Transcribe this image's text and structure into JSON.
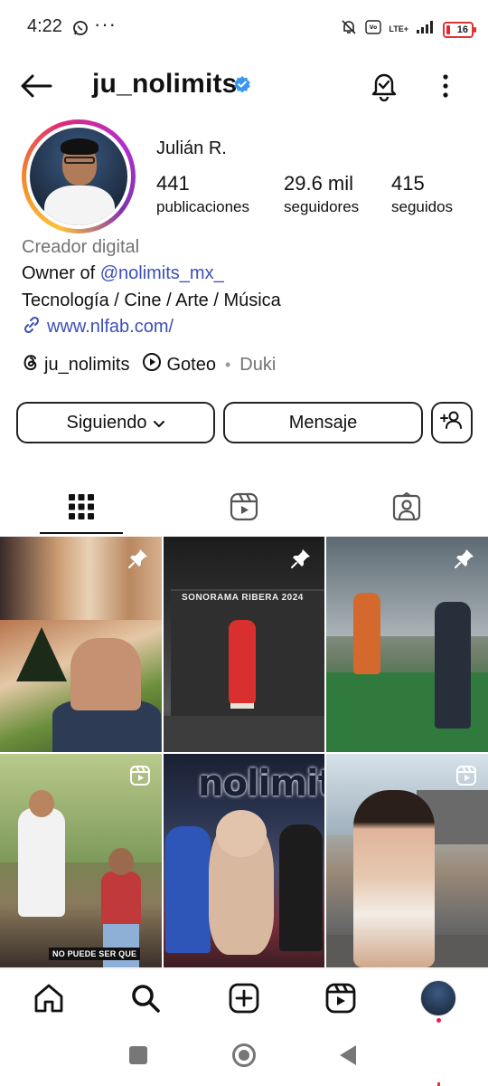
{
  "status_bar": {
    "time": "4:22",
    "network": "LTE+",
    "battery": "16"
  },
  "header": {
    "username": "ju_nolimits",
    "verified": true,
    "icons": [
      "back-arrow-icon",
      "verified-badge-icon",
      "notification-bell-icon",
      "more-vertical-icon"
    ]
  },
  "profile": {
    "full_name": "Julián R.",
    "stats": {
      "posts": {
        "value": "441",
        "label": "publicaciones"
      },
      "followers": {
        "value": "29.6 mil",
        "label": "seguidores"
      },
      "following": {
        "value": "415",
        "label": "seguidos"
      }
    },
    "category": "Creador digital",
    "bio_prefix": "Owner of ",
    "bio_mention": "@nolimits_mx_",
    "bio_line2": "Tecnología / Cine / Arte / Música",
    "link": "www.nlfab.com/",
    "threads_handle": "ju_nolimits",
    "music_title": "Goteo",
    "music_separator": "•",
    "music_artist": "Duki"
  },
  "actions": {
    "following_label": "Siguiendo",
    "message_label": "Mensaje"
  },
  "tabs": [
    {
      "name": "grid",
      "icon": "grid-icon",
      "active": true
    },
    {
      "name": "reels",
      "icon": "reels-icon",
      "active": false
    },
    {
      "name": "tagged",
      "icon": "tagged-icon",
      "active": false
    }
  ],
  "grid": {
    "posts": [
      {
        "type": "image",
        "pinned": true
      },
      {
        "type": "image",
        "pinned": true,
        "text": "SONORAMA RIBERA 2024"
      },
      {
        "type": "image",
        "pinned": true
      },
      {
        "type": "reel",
        "pinned": false,
        "caption": "NO PUEDE SER QUE"
      },
      {
        "type": "image",
        "pinned": false,
        "text": "nolimits"
      },
      {
        "type": "reel",
        "pinned": false
      }
    ]
  },
  "bottom_nav": {
    "items": [
      "home-icon",
      "search-icon",
      "create-icon",
      "reels-icon",
      "profile-avatar"
    ]
  },
  "colors": {
    "link": "#3b4fb8",
    "verified": "#3897f0",
    "secondary_text": "#737373",
    "notification": "#ed1c4a"
  }
}
